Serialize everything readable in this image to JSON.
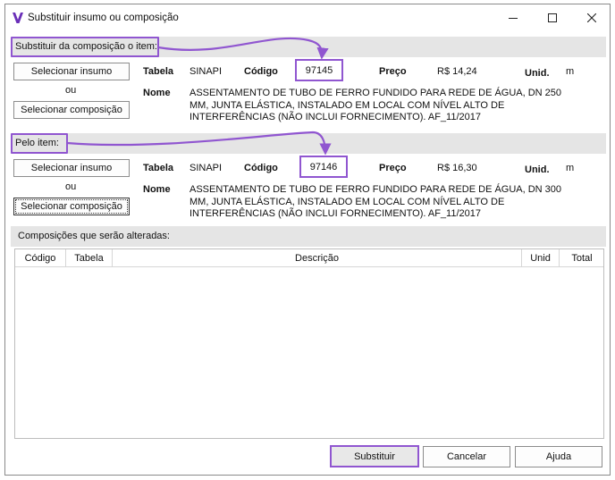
{
  "window": {
    "title": "Substituir insumo ou composição"
  },
  "source": {
    "section_label": "Substituir da composição o item:",
    "select_input_label": "Selecionar insumo",
    "or_label": "ou",
    "select_composition_label": "Selecionar composição",
    "table_label": "Tabela",
    "table_value": "SINAPI",
    "code_label": "Código",
    "code_value": "97145",
    "price_label": "Preço",
    "price_value": "R$ 14,24",
    "unit_label": "Unid.",
    "unit_value": "m",
    "name_label": "Nome",
    "name_value": "ASSENTAMENTO DE TUBO DE FERRO FUNDIDO PARA REDE DE ÁGUA, DN 250 MM, JUNTA ELÁSTICA, INSTALADO EM LOCAL COM NÍVEL ALTO DE INTERFERÊNCIAS (NÃO INCLUI FORNECIMENTO). AF_11/2017"
  },
  "target": {
    "section_label": "Pelo item:",
    "select_input_label": "Selecionar insumo",
    "or_label": "ou",
    "select_composition_label": "Selecionar composição",
    "table_label": "Tabela",
    "table_value": "SINAPI",
    "code_label": "Código",
    "code_value": "97146",
    "price_label": "Preço",
    "price_value": "R$ 16,30",
    "unit_label": "Unid.",
    "unit_value": "m",
    "name_label": "Nome",
    "name_value": "ASSENTAMENTO DE TUBO DE FERRO FUNDIDO PARA REDE DE ÁGUA, DN 300 MM, JUNTA ELÁSTICA, INSTALADO EM LOCAL COM NÍVEL ALTO DE INTERFERÊNCIAS (NÃO INCLUI FORNECIMENTO). AF_11/2017"
  },
  "affected": {
    "section_label": "Composições que serão alteradas:",
    "columns": [
      "Código",
      "Tabela",
      "Descrição",
      "Unid",
      "Total"
    ]
  },
  "footer": {
    "replace_label": "Substituir",
    "cancel_label": "Cancelar",
    "help_label": "Ajuda"
  },
  "colors": {
    "highlight": "#9056d0",
    "section_bg": "#e5e5e5"
  }
}
